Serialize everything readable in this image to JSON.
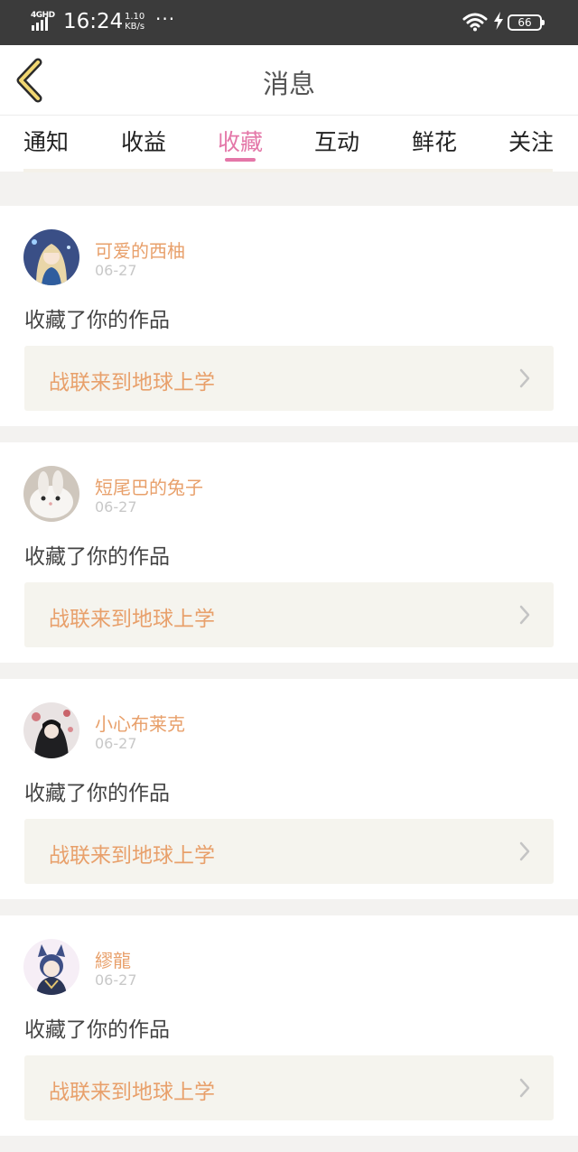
{
  "status_bar": {
    "network": "4GHD",
    "time": "16:24",
    "speed_value": "1.10",
    "speed_unit": "KB/s",
    "more": "···",
    "battery": "66"
  },
  "header": {
    "title": "消息"
  },
  "tabs": [
    {
      "label": "通知",
      "active": false
    },
    {
      "label": "收益",
      "active": false
    },
    {
      "label": "收藏",
      "active": true
    },
    {
      "label": "互动",
      "active": false
    },
    {
      "label": "鲜花",
      "active": false
    },
    {
      "label": "关注",
      "active": false
    }
  ],
  "colors": {
    "accent": "#e477a8",
    "name_orange": "#e8a06b",
    "card_link_bg": "#f5f4ee",
    "page_bg": "#f3f2f0"
  },
  "items": [
    {
      "user": "可爱的西柚",
      "date": "06-27",
      "action": "收藏了你的作品",
      "work": "战联来到地球上学",
      "avatar_icon": "anime-girl-avatar"
    },
    {
      "user": "短尾巴的兔子",
      "date": "06-27",
      "action": "收藏了你的作品",
      "work": "战联来到地球上学",
      "avatar_icon": "white-rabbit-avatar"
    },
    {
      "user": "小心布莱克",
      "date": "06-27",
      "action": "收藏了你的作品",
      "work": "战联来到地球上学",
      "avatar_icon": "dark-anime-avatar"
    },
    {
      "user": "繆龍",
      "date": "06-27",
      "action": "收藏了你的作品",
      "work": "战联来到地球上学",
      "avatar_icon": "catboy-anime-avatar"
    }
  ]
}
